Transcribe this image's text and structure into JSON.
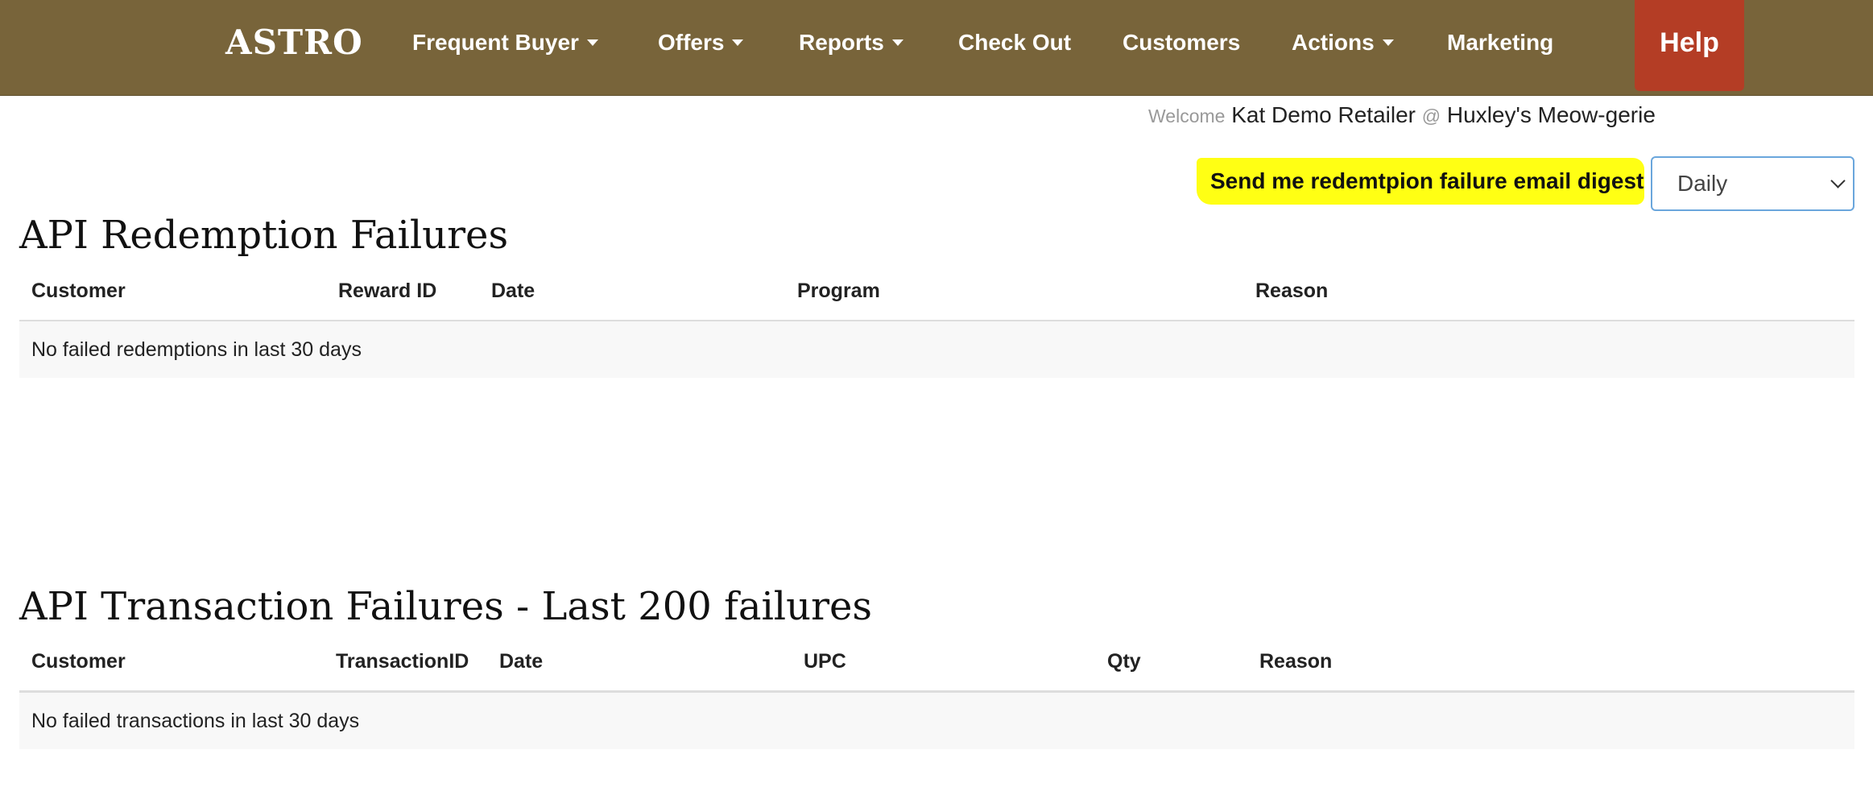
{
  "nav": {
    "brand": "ASTRO",
    "items": [
      {
        "label": "Frequent Buyer",
        "dropdown": true
      },
      {
        "label": "Offers",
        "dropdown": true
      },
      {
        "label": "Reports",
        "dropdown": true
      },
      {
        "label": "Check Out",
        "dropdown": false
      },
      {
        "label": "Customers",
        "dropdown": false
      },
      {
        "label": "Actions",
        "dropdown": true
      },
      {
        "label": "Marketing",
        "dropdown": false
      }
    ],
    "help": "Help"
  },
  "welcome": {
    "prefix": "Welcome",
    "user": "Kat Demo Retailer",
    "at": "@",
    "store": "Huxley's Meow-gerie"
  },
  "digest": {
    "label": "Send me redemtpion failure email digest",
    "selected": "Daily"
  },
  "redemption": {
    "title": "API Redemption Failures",
    "columns": [
      "Customer",
      "Reward ID",
      "Date",
      "Program",
      "Reason"
    ],
    "empty": "No failed redemptions in last 30 days"
  },
  "transactions": {
    "title": "API Transaction Failures - Last 200 failures",
    "columns": [
      "Customer",
      "TransactionID",
      "Date",
      "UPC",
      "Qty",
      "Reason"
    ],
    "empty": "No failed transactions in last 30 days"
  },
  "colors": {
    "navbar": "#78643a",
    "help": "#b43d25",
    "highlight": "#ffff14",
    "select_border": "#6aa6dc"
  }
}
